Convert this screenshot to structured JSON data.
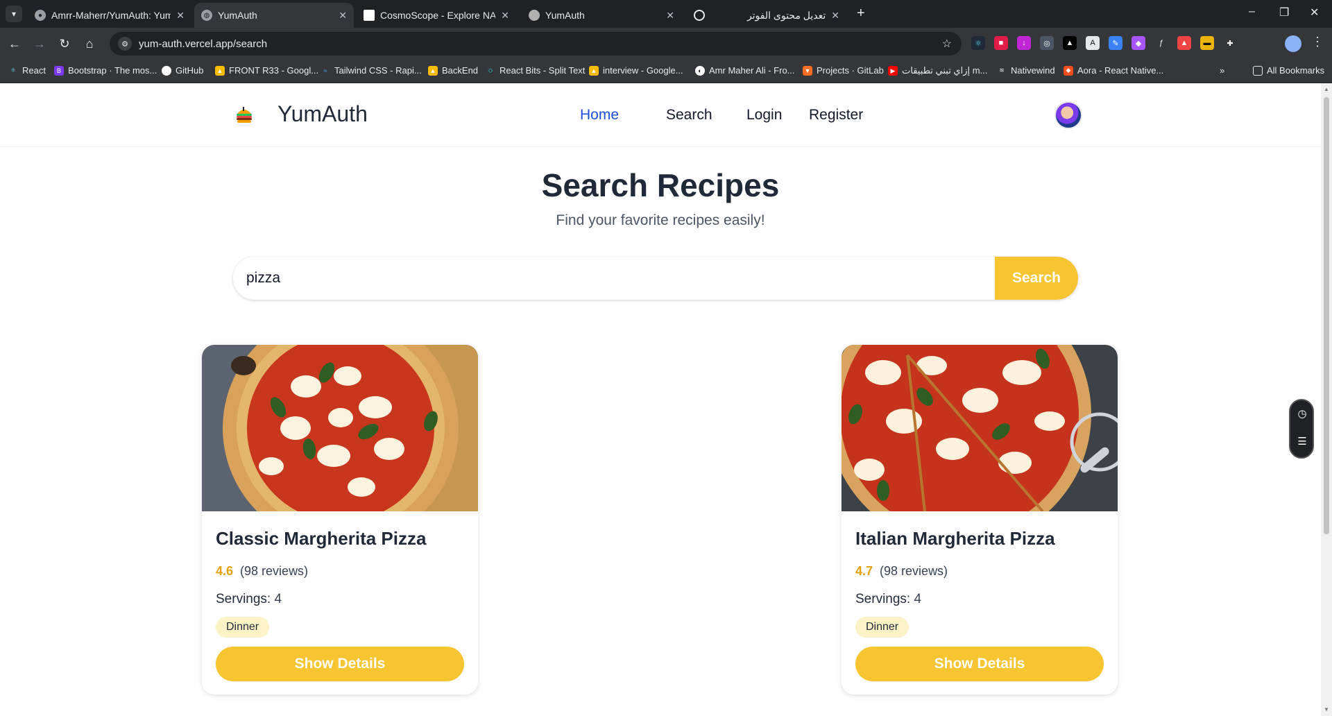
{
  "browser": {
    "tabs": [
      {
        "title": "Amrr-Maherr/YumAuth: YumAuth",
        "active": false
      },
      {
        "title": "YumAuth",
        "active": true
      },
      {
        "title": "CosmoScope - Explore NASA's",
        "active": false
      },
      {
        "title": "YumAuth",
        "active": false
      },
      {
        "title": "تعديل محتوى الفوتر",
        "active": false
      }
    ],
    "url": "yum-auth.vercel.app/search",
    "bookmarks": [
      "React",
      "Bootstrap · The mos...",
      "GitHub",
      "FRONT R33 - Googl...",
      "Tailwind CSS - Rapi...",
      "BackEnd",
      "React Bits - Split Text",
      "interview - Google...",
      "Amr Maher Ali - Fro...",
      "Projects · GitLab",
      "إزاي تبني تطبيقات m...",
      "Nativewind",
      "Aora - React Native...",
      "All Bookmarks"
    ],
    "more_bookmarks": "»"
  },
  "site": {
    "brand": "YumAuth",
    "nav": [
      "Home",
      "Search",
      "Login",
      "Register"
    ],
    "active_nav": "Home"
  },
  "page": {
    "title": "Search Recipes",
    "subtitle": "Find your favorite recipes easily!"
  },
  "search": {
    "value": "pizza",
    "button_label": "Search"
  },
  "recipes": [
    {
      "title": "Classic Margherita Pizza",
      "rating": "4.6",
      "reviews": "(98 reviews)",
      "servings_label": "Servings:",
      "servings": "4",
      "tag": "Dinner",
      "button": "Show Details"
    },
    {
      "title": "Italian Margherita Pizza",
      "rating": "4.7",
      "reviews": "(98 reviews)",
      "servings_label": "Servings:",
      "servings": "4",
      "tag": "Dinner",
      "button": "Show Details"
    }
  ],
  "colors": {
    "accent": "#f7c531",
    "active_nav": "#1d4ed8",
    "rating": "#e5a00d",
    "tag_bg": "#fef3c7"
  }
}
